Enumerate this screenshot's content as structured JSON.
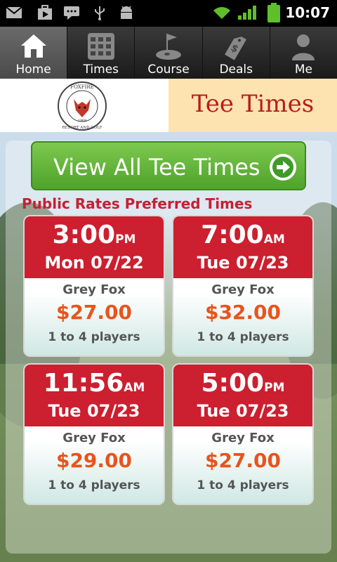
{
  "status_bar": {
    "time": "10:07",
    "icons": [
      "gmail-icon",
      "play-store-icon",
      "chat-icon",
      "usb-icon",
      "android-debug-icon",
      "wifi-icon",
      "signal-icon",
      "battery-icon"
    ]
  },
  "tabs": [
    {
      "label": "Home",
      "icon": "home-icon",
      "active": true
    },
    {
      "label": "Times",
      "icon": "calendar-grid-icon",
      "active": false
    },
    {
      "label": "Course",
      "icon": "golf-flag-icon",
      "active": false
    },
    {
      "label": "Deals",
      "icon": "price-tag-icon",
      "active": false
    },
    {
      "label": "Me",
      "icon": "person-icon",
      "active": false
    }
  ],
  "header": {
    "title": "Tee Times",
    "logo_text": "FOXFIRE RESORT AND GOLF",
    "logo_year": "1968"
  },
  "view_all_label": "View All Tee Times",
  "section_title": "Public Rates Preferred Times",
  "tee_times": [
    {
      "time": "3:00",
      "ampm": "PM",
      "date": "Mon 07/22",
      "course": "Grey Fox",
      "price": "$27.00",
      "players": "1 to 4 players"
    },
    {
      "time": "7:00",
      "ampm": "AM",
      "date": "Tue 07/23",
      "course": "Grey Fox",
      "price": "$32.00",
      "players": "1 to 4 players"
    },
    {
      "time": "11:56",
      "ampm": "AM",
      "date": "Tue 07/23",
      "course": "Grey Fox",
      "price": "$29.00",
      "players": "1 to 4 players"
    },
    {
      "time": "5:00",
      "ampm": "PM",
      "date": "Tue 07/23",
      "course": "Grey Fox",
      "price": "$27.00",
      "players": "1 to 4 players"
    }
  ],
  "colors": {
    "accent_red": "#cc1f2f",
    "price_orange": "#e8541c",
    "button_green": "#5cb132",
    "header_tan": "#fde3b0"
  }
}
